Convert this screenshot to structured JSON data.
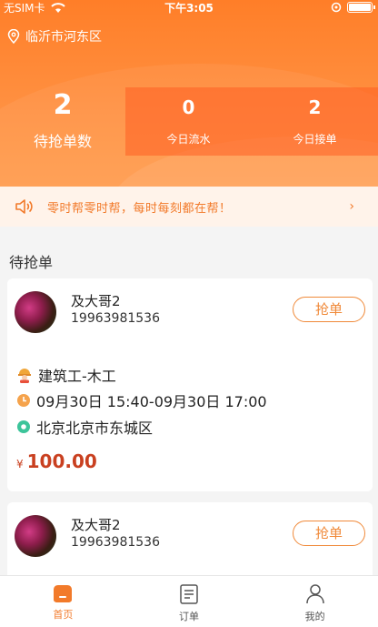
{
  "status_bar": {
    "carrier": "无SIM卡",
    "time": "下午3:05"
  },
  "location": "临沂市河东区",
  "stats": {
    "pending": {
      "value": "2",
      "label": "待抢单数"
    },
    "today_flow": {
      "value": "0",
      "label": "今日流水"
    },
    "today_accepted": {
      "value": "2",
      "label": "今日接单"
    }
  },
  "notice": "零时帮零时帮，每时每刻都在帮！",
  "section_title": "待抢单",
  "orders": [
    {
      "name": "及大哥2",
      "phone": "19963981536",
      "button": "抢单",
      "job": "建筑工-木工",
      "time": "09月30日 15:40-09月30日 17:00",
      "address": "北京北京市东城区",
      "currency": "¥",
      "price": "100.00"
    },
    {
      "name": "及大哥2",
      "phone": "19963981536",
      "button": "抢单"
    }
  ],
  "tabs": [
    {
      "label": "首页",
      "icon": "home-icon"
    },
    {
      "label": "订单",
      "icon": "orders-icon"
    },
    {
      "label": "我的",
      "icon": "profile-icon"
    }
  ],
  "colors": {
    "accent": "#f27a2a",
    "header": "#ff8a3a",
    "price": "#c94020"
  }
}
